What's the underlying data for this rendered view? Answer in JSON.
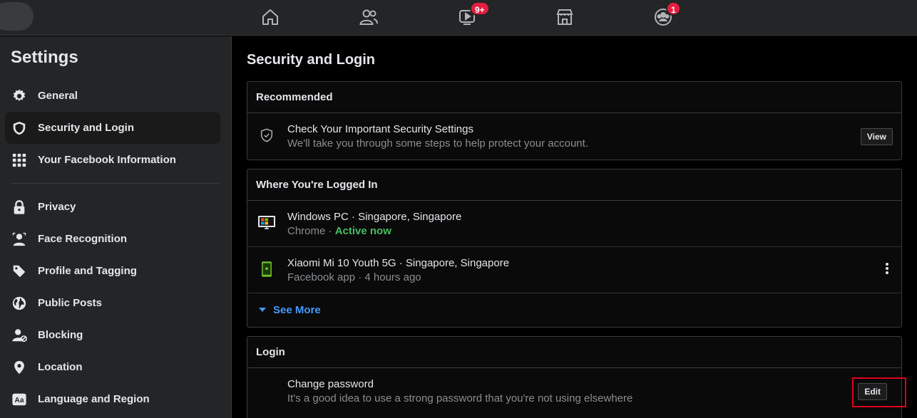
{
  "topbar": {
    "icons": [
      "home-icon",
      "friends-icon",
      "watch-icon",
      "marketplace-icon",
      "groups-icon"
    ],
    "watch_badge": "9+",
    "groups_badge": "1"
  },
  "sidebar": {
    "title": "Settings",
    "items": [
      {
        "label": "General",
        "icon": "gear-icon"
      },
      {
        "label": "Security and Login",
        "icon": "shield-icon"
      },
      {
        "label": "Your Facebook Information",
        "icon": "grid-icon"
      },
      {
        "label": "Privacy",
        "icon": "lock-icon"
      },
      {
        "label": "Face Recognition",
        "icon": "face-recognition-icon"
      },
      {
        "label": "Profile and Tagging",
        "icon": "tag-icon"
      },
      {
        "label": "Public Posts",
        "icon": "globe-icon"
      },
      {
        "label": "Blocking",
        "icon": "blocking-icon"
      },
      {
        "label": "Location",
        "icon": "location-pin-icon"
      },
      {
        "label": "Language and Region",
        "icon": "language-icon"
      }
    ]
  },
  "main": {
    "title": "Security and Login",
    "recommended": {
      "header": "Recommended",
      "title": "Check Your Important Security Settings",
      "subtitle": "We'll take you through some steps to help protect your account.",
      "button": "View"
    },
    "logged_in": {
      "header": "Where You're Logged In",
      "sessions": [
        {
          "device": "Windows PC · Singapore, Singapore",
          "app": "Chrome · ",
          "status": "Active now"
        },
        {
          "device": "Xiaomi Mi 10 Youth 5G · Singapore, Singapore",
          "app": "Facebook app · 4 hours ago",
          "status": ""
        }
      ],
      "see_more": "See More"
    },
    "login": {
      "header": "Login",
      "title": "Change password",
      "subtitle": "It's a good idea to use a strong password that you're not using elsewhere",
      "button": "Edit"
    }
  },
  "colors": {
    "active_green": "#45bd62",
    "link_blue": "#4599ff",
    "badge_red": "#e41e3f",
    "highlight_red": "#e0001b"
  }
}
